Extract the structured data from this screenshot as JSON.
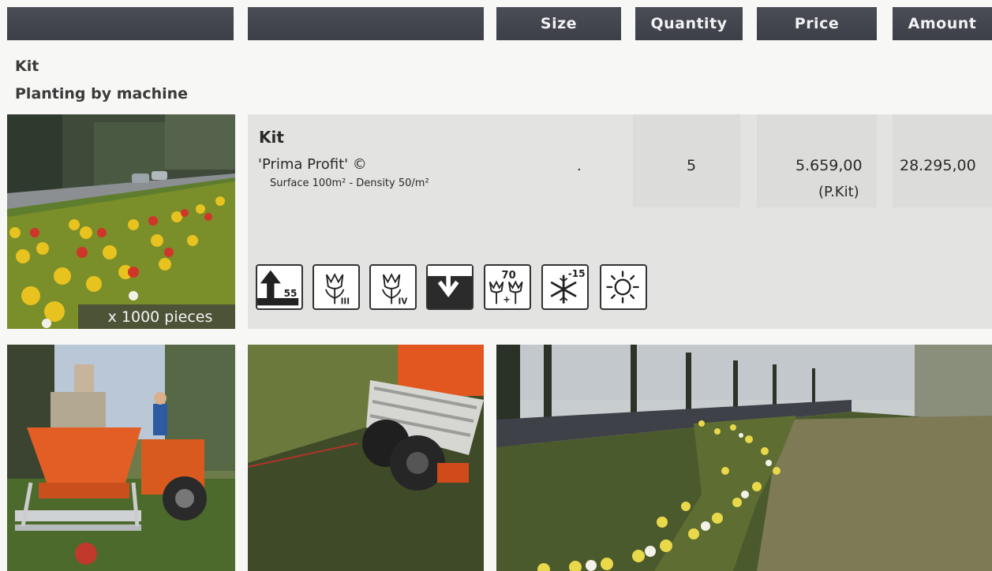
{
  "header": {
    "col1": "",
    "col2": "",
    "size": "Size",
    "quantity": "Quantity",
    "price": "Price",
    "amount": "Amount"
  },
  "section": {
    "title": "Kit",
    "subtitle": "Planting by machine"
  },
  "product": {
    "kit_label": "Kit",
    "name": "'Prima Profit' ©",
    "details": "Surface 100m² -  Density 50/m²",
    "size": ".",
    "quantity": "5",
    "price": "5.659,00",
    "price_unit": "(P.Kit)",
    "amount": "28.295,00",
    "badge": "x 1000 pieces",
    "icons": [
      {
        "name": "height-icon",
        "value": "55"
      },
      {
        "name": "flowering-period-icon",
        "value": "III"
      },
      {
        "name": "flowering-period-icon",
        "value": "IV"
      },
      {
        "name": "planting-depth-icon",
        "value": ""
      },
      {
        "name": "bulbs-per-m2-icon",
        "value": "70"
      },
      {
        "name": "frost-hardiness-icon",
        "value": "-15"
      },
      {
        "name": "full-sun-icon",
        "value": ""
      }
    ]
  },
  "colors": {
    "header_bg": "#43464e",
    "header_text": "#f2f2f2",
    "panel_bg": "#e3e3e1"
  }
}
